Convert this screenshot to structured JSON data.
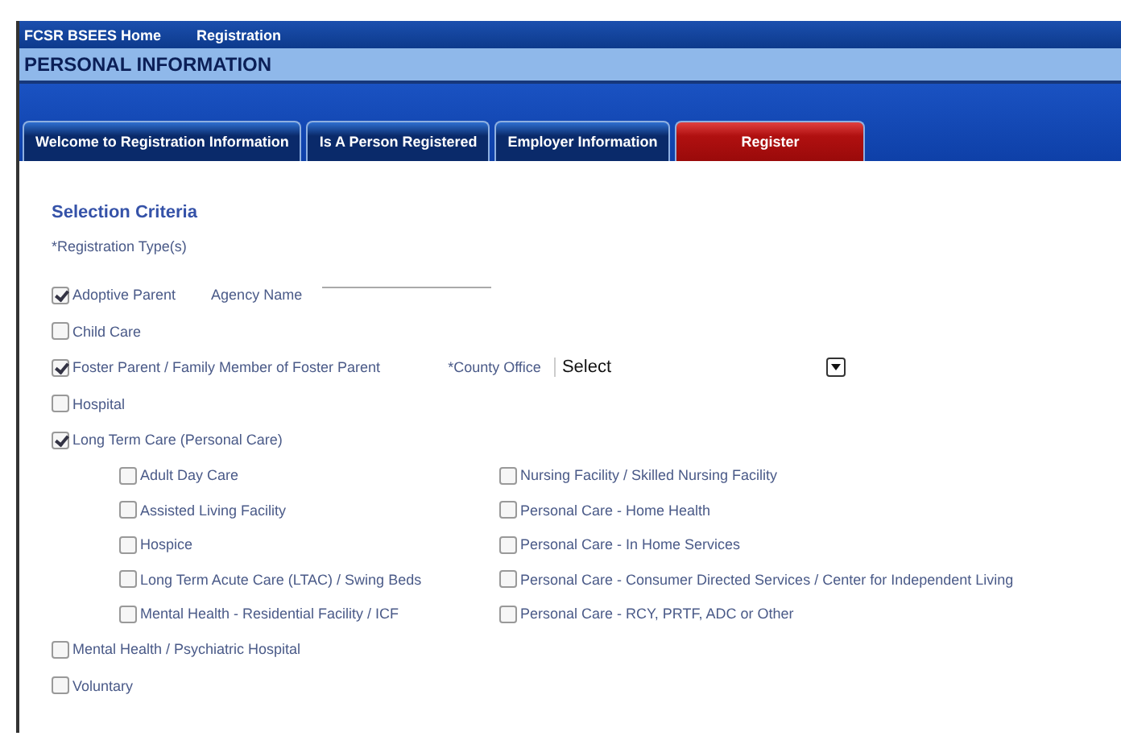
{
  "nav": {
    "links": [
      "FCSR BSEES Home",
      "Registration"
    ]
  },
  "header": {
    "title": "PERSONAL INFORMATION"
  },
  "tabs": [
    {
      "label": "Welcome to Registration Information",
      "selected": false,
      "kind": "normal"
    },
    {
      "label": "Is A Person Registered",
      "selected": false,
      "kind": "normal"
    },
    {
      "label": "Employer Information",
      "selected": false,
      "kind": "normal"
    },
    {
      "label": "Register",
      "selected": true,
      "kind": "action"
    }
  ],
  "section": {
    "title": "Selection Criteria",
    "label": "*Registration Type(s)"
  },
  "options": [
    {
      "label": "Adoptive Parent",
      "checked": true,
      "extra": {
        "kind": "text",
        "label": "Agency Name"
      }
    },
    {
      "label": "Child Care",
      "checked": false
    },
    {
      "label": "Foster Parent / Family Member of Foster Parent",
      "checked": true,
      "extra": {
        "kind": "select",
        "label": "*County Office",
        "value": "Select"
      }
    },
    {
      "label": "Hospital",
      "checked": false
    },
    {
      "label": "Long Term Care (Personal Care)",
      "checked": true,
      "children": [
        {
          "label": "Adult Day Care",
          "checked": false
        },
        {
          "label": "Nursing Facility / Skilled Nursing Facility",
          "checked": false
        },
        {
          "label": "Assisted Living Facility",
          "checked": false
        },
        {
          "label": "Personal Care - Home Health",
          "checked": false
        },
        {
          "label": "Hospice",
          "checked": false
        },
        {
          "label": "Personal Care - In Home Services",
          "checked": false
        },
        {
          "label": "Long Term Acute Care (LTAC) / Swing Beds",
          "checked": false
        },
        {
          "label": "Personal Care - Consumer Directed Services / Center for Independent Living",
          "checked": false
        },
        {
          "label": "Mental Health - Residential Facility / ICF",
          "checked": false
        },
        {
          "label": "Personal Care - RCY, PRTF, ADC or Other",
          "checked": false
        }
      ]
    },
    {
      "label": "Mental Health / Psychiatric Hospital",
      "checked": false
    },
    {
      "label": "Voluntary",
      "checked": false
    }
  ]
}
